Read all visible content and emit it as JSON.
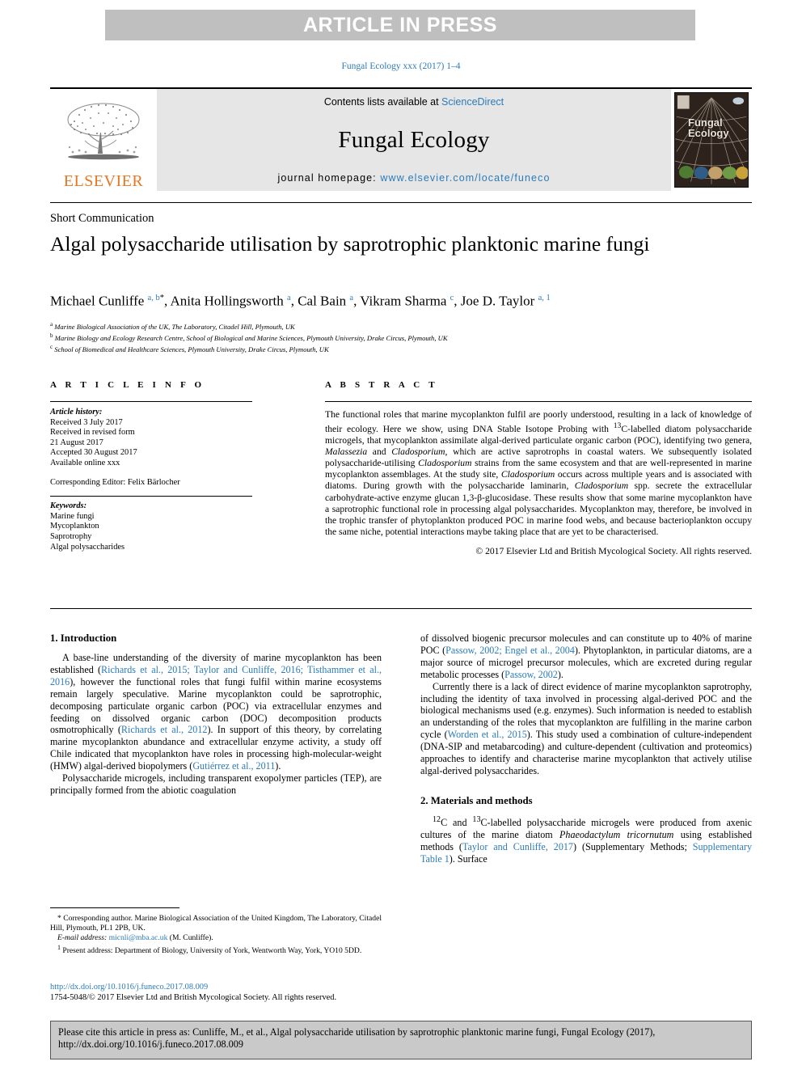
{
  "banner": {
    "text": "ARTICLE IN PRESS"
  },
  "journal_line": "Fungal Ecology xxx (2017) 1–4",
  "masthead": {
    "publisher": "ELSEVIER",
    "contents_prefix": "Contents lists available at ",
    "contents_link": "ScienceDirect",
    "journal_name": "Fungal Ecology",
    "homepage_prefix": "journal homepage: ",
    "homepage_url": "www.elsevier.com/locate/funeco",
    "cover_title_line1": "Fungal",
    "cover_title_line2": "Ecology"
  },
  "article": {
    "type": "Short Communication",
    "title": "Algal polysaccharide utilisation by saprotrophic planktonic marine fungi",
    "authors_html": "Michael Cunliffe <sup>a, b</sup><sup class=\"star\">*</sup>, Anita Hollingsworth <sup>a</sup>, Cal Bain <sup>a</sup>, Vikram Sharma <sup>c</sup>, Joe D. Taylor <sup>a, 1</sup>",
    "affiliations": [
      {
        "mark": "a",
        "text": "Marine Biological Association of the UK, The Laboratory, Citadel Hill, Plymouth, UK"
      },
      {
        "mark": "b",
        "text": "Marine Biology and Ecology Research Centre, School of Biological and Marine Sciences, Plymouth University, Drake Circus, Plymouth, UK"
      },
      {
        "mark": "c",
        "text": "School of Biomedical and Healthcare Sciences, Plymouth University, Drake Circus, Plymouth, UK"
      }
    ]
  },
  "article_info": {
    "heading": "A R T I C L E   I N F O",
    "history_label": "Article history:",
    "history_lines": [
      "Received 3 July 2017",
      "Received in revised form",
      "21 August 2017",
      "Accepted 30 August 2017",
      "Available online xxx"
    ],
    "editor": "Corresponding Editor: Felix Bärlocher",
    "keywords_label": "Keywords:",
    "keywords": [
      "Marine fungi",
      "Mycoplankton",
      "Saprotrophy",
      "Algal polysaccharides"
    ]
  },
  "abstract": {
    "heading": "A B S T R A C T",
    "body_html": "The functional roles that marine mycoplankton fulfil are poorly understood, resulting in a lack of knowledge of their ecology. Here we show, using DNA Stable Isotope Probing with <sup>13</sup>C-labelled diatom polysaccharide microgels, that mycoplankton assimilate algal-derived particulate organic carbon (POC), identifying two genera, <i>Malassezia</i> and <i>Cladosporium</i>, which are active saprotrophs in coastal waters. We subsequently isolated polysaccharide-utilising <i>Cladosporium</i> strains from the same ecosystem and that are well-represented in marine mycoplankton assemblages. At the study site, <i>Cladosporium</i> occurs across multiple years and is associated with diatoms. During growth with the polysaccharide laminarin, <i>Cladosporium</i> spp. secrete the extracellular carbohydrate-active enzyme glucan 1,3-β-glucosidase. These results show that some marine mycoplankton have a saprotrophic functional role in processing algal polysaccharides. Mycoplankton may, therefore, be involved in the trophic transfer of phytoplankton produced POC in marine food webs, and because bacterioplankton occupy the same niche, potential interactions maybe taking place that are yet to be characterised.",
    "copyright": "© 2017 Elsevier Ltd and British Mycological Society. All rights reserved."
  },
  "sections": {
    "introduction_heading": "1.  Introduction",
    "intro_p1_html": "A base-line understanding of the diversity of marine mycoplankton has been established (<span class=\"lnk\">Richards et al., 2015; Taylor and Cunliffe, 2016; Tisthammer et al., 2016</span>), however the functional roles that fungi fulfil within marine ecosystems remain largely speculative. Marine mycoplankton could be saprotrophic, decomposing particulate organic carbon (POC) via extracellular enzymes and feeding on dissolved organic carbon (DOC) decomposition products osmotrophically (<span class=\"lnk\">Richards et al., 2012</span>). In support of this theory, by correlating marine mycoplankton abundance and extracellular enzyme activity, a study off Chile indicated that mycoplankton have roles in processing high-molecular-weight (HMW) algal-derived biopolymers (<span class=\"lnk\">Gutiérrez et al., 2011</span>).",
    "intro_p2_html": "Polysaccharide microgels, including transparent exopolymer particles (TEP), are principally formed from the abiotic coagulation",
    "intro_p3_html": "of dissolved biogenic precursor molecules and can constitute up to 40% of marine POC (<span class=\"lnk\">Passow, 2002; Engel et al., 2004</span>). Phytoplankton, in particular diatoms, are a major source of microgel precursor molecules, which are excreted during regular metabolic processes (<span class=\"lnk\">Passow, 2002</span>).",
    "intro_p4_html": "Currently there is a lack of direct evidence of marine mycoplankton saprotrophy, including the identity of taxa involved in processing algal-derived POC and the biological mechanisms used (e.g. enzymes). Such information is needed to establish an understanding of the roles that mycoplankton are fulfilling in the marine carbon cycle (<span class=\"lnk\">Worden et al., 2015</span>). This study used a combination of culture-independent (DNA-SIP and metabarcoding) and culture-dependent (cultivation and proteomics) approaches to identify and characterise marine mycoplankton that actively utilise algal-derived polysaccharides.",
    "methods_heading": "2.  Materials and methods",
    "methods_p1_html": "<sup>12</sup>C and <sup>13</sup>C-labelled polysaccharide microgels were produced from axenic cultures of the marine diatom <i>Phaeodactylum tricornutum</i> using established methods (<span class=\"lnk\">Taylor and Cunliffe, 2017</span>) (Supplementary Methods; <span class=\"lnk\">Supplementary Table 1</span>). Surface"
  },
  "footnotes": {
    "corresponding_html": "* Corresponding author. Marine Biological Association of the United Kingdom, The Laboratory, Citadel Hill, Plymouth, PL1 2PB, UK.",
    "email_html": "<span class=\"eml\">E-mail address:</span> <span class=\"lnk\">micnli@mba.ac.uk</span> (M. Cunliffe).",
    "present_address_html": "<sup>1</sup> Present address: Department of Biology, University of York, Wentworth Way, York, YO10 5DD."
  },
  "doi": {
    "url": "http://dx.doi.org/10.1016/j.funeco.2017.08.009",
    "issn_line": "1754-5048/© 2017 Elsevier Ltd and British Mycological Society. All rights reserved."
  },
  "cite_box": {
    "text": "Please cite this article in press as: Cunliffe, M., et al., Algal polysaccharide utilisation by saprotrophic planktonic marine fungi, Fungal Ecology (2017), http://dx.doi.org/10.1016/j.funeco.2017.08.009"
  },
  "colors": {
    "link": "#2b7bb9",
    "banner_bg": "#bfbfbf",
    "masthead_bg": "#e6e6e6",
    "elsevier_orange": "#E87722",
    "cite_bg": "#c9c9c9"
  }
}
